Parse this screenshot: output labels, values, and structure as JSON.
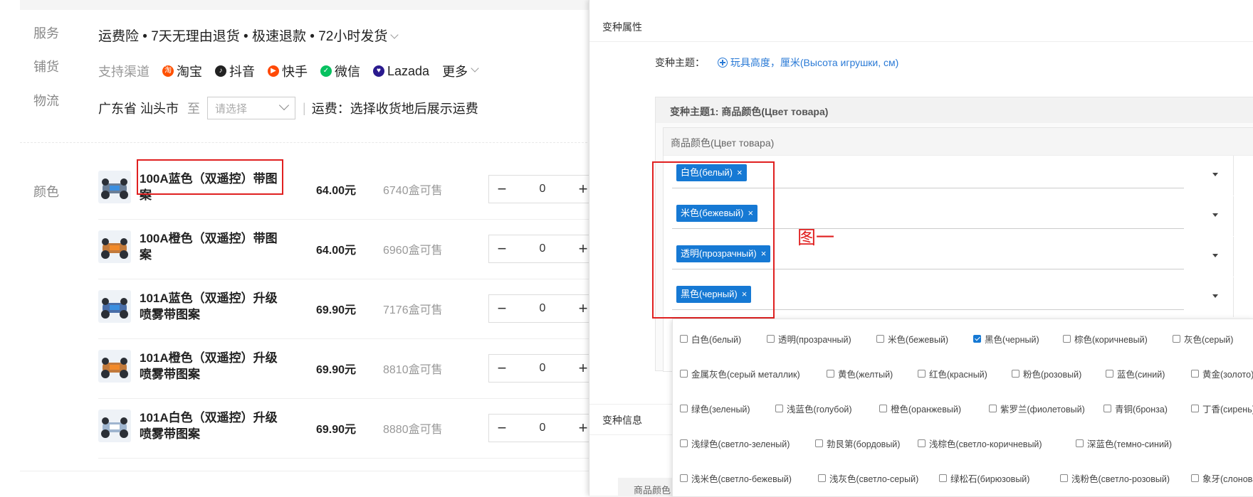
{
  "left": {
    "service_label": "服务",
    "service_text": "运费险 • 7天无理由退货 • 极速退款 • 72小时发货",
    "distribution_label": "铺货",
    "channels_label": "支持渠道",
    "channels": [
      "淘宝",
      "抖音",
      "快手",
      "微信",
      "Lazada"
    ],
    "more_label": "更多",
    "logistics_label": "物流",
    "origin": "广东省 汕头市",
    "to_label": "至",
    "destination_placeholder": "请选择",
    "shipping_text": "运费：选择收货地后展示运费",
    "color_label": "颜色",
    "products": [
      {
        "name": "100A蓝色（双遥控）带图案",
        "price": "64.00元",
        "stock": "6740盒可售",
        "qty": "0"
      },
      {
        "name": "100A橙色（双遥控）带图案",
        "price": "64.00元",
        "stock": "6960盒可售",
        "qty": "0"
      },
      {
        "name": "101A蓝色（双遥控）升级喷雾带图案",
        "price": "69.90元",
        "stock": "7176盒可售",
        "qty": "0"
      },
      {
        "name": "101A橙色（双遥控）升级喷雾带图案",
        "price": "69.90元",
        "stock": "8810盒可售",
        "qty": "0"
      },
      {
        "name": "101A白色（双遥控）升级喷雾带图案",
        "price": "69.90元",
        "stock": "8880盒可售",
        "qty": "0"
      }
    ],
    "minus": "−",
    "plus": "+"
  },
  "right": {
    "section_variant_attr": "变种属性",
    "theme_label": "变种主题：",
    "theme_link": "玩具高度，厘米(Высота игрушки, см)",
    "theme1_title": "变种主题1:   商品颜色(Цвет товара)",
    "field_header": "商品颜色(Цвет товара)",
    "selected_tags": [
      "白色(белый)",
      "米色(бежевый)",
      "透明(прозрачный)",
      "黑色(черный)"
    ],
    "tag_remove": "×",
    "annotation": "图一",
    "section_variant_info": "变种信息",
    "bottom_tab": "商品颜色"
  },
  "dropdown": {
    "rows": [
      [
        {
          "label": "白色(белый)",
          "checked": false
        },
        {
          "label": "透明(прозрачный)",
          "checked": false
        },
        {
          "label": "米色(бежевый)",
          "checked": false
        },
        {
          "label": "黑色(черный)",
          "checked": true
        },
        {
          "label": "棕色(коричневый)",
          "checked": false
        },
        {
          "label": "灰色(серый)",
          "checked": false
        }
      ],
      [
        {
          "label": "金属灰色(серый металлик)",
          "checked": false
        },
        {
          "label": "黄色(желтый)",
          "checked": false
        },
        {
          "label": "红色(красный)",
          "checked": false
        },
        {
          "label": "粉色(розовый)",
          "checked": false
        },
        {
          "label": "蓝色(синий)",
          "checked": false
        },
        {
          "label": "黄金(золото)",
          "checked": false
        }
      ],
      [
        {
          "label": "绿色(зеленый)",
          "checked": false
        },
        {
          "label": "浅蓝色(голубой)",
          "checked": false
        },
        {
          "label": "橙色(оранжевый)",
          "checked": false
        },
        {
          "label": "紫罗兰(фиолетовый)",
          "checked": false
        },
        {
          "label": "青铜(бронза)",
          "checked": false
        },
        {
          "label": "丁香(сирень)",
          "checked": false
        }
      ],
      [
        {
          "label": "浅绿色(светло-зеленый)",
          "checked": false
        },
        {
          "label": "勃艮第(бордовый)",
          "checked": false
        },
        {
          "label": "浅棕色(светло-коричневый)",
          "checked": false
        },
        {
          "label": "深蓝色(темно-синий)",
          "checked": false
        }
      ],
      [
        {
          "label": "浅米色(светло-бежевый)",
          "checked": false
        },
        {
          "label": "浅灰色(светло-серый)",
          "checked": false
        },
        {
          "label": "绿松石(бирюзовый)",
          "checked": false
        },
        {
          "label": "浅粉色(светло-розовый)",
          "checked": false
        },
        {
          "label": "象牙(слоновая кость)",
          "checked": false
        }
      ]
    ]
  },
  "colors": {
    "accent": "#1679d4",
    "annotation_red": "#e02020",
    "taobao": "#ff5000",
    "douyin": "#222222",
    "kuaishou": "#ff4906",
    "wechat": "#07c160",
    "lazada": "#2a1a8e"
  }
}
